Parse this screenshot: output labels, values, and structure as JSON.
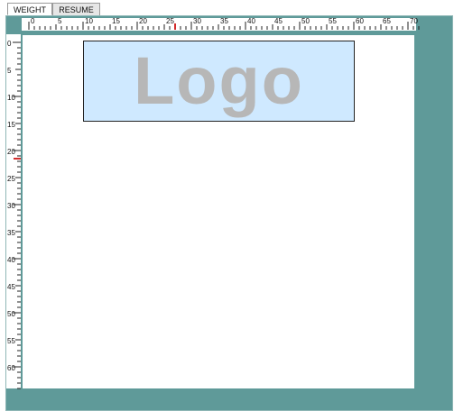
{
  "tabs": [
    {
      "label": "WEIGHT",
      "active": true
    },
    {
      "label": "RESUME",
      "active": false
    }
  ],
  "rulers": {
    "horizontal_labels": [
      "0",
      "5",
      "10",
      "15",
      "20",
      "25",
      "30",
      "35",
      "40",
      "45",
      "50",
      "55",
      "60",
      "65",
      "70"
    ],
    "vertical_labels": [
      "0",
      "5",
      "10",
      "15",
      "20",
      "25",
      "30",
      "35",
      "40",
      "45",
      "50",
      "55",
      "60"
    ],
    "marker_color": "#d22b2b",
    "horizontal_marker_value": 27,
    "vertical_marker_value": 21.5
  },
  "logo": {
    "text": "Logo",
    "background": "#cfe9ff",
    "text_color": "#b7b7b7"
  },
  "colors": {
    "workspace": "#5f9a99",
    "canvas": "#ffffff"
  }
}
